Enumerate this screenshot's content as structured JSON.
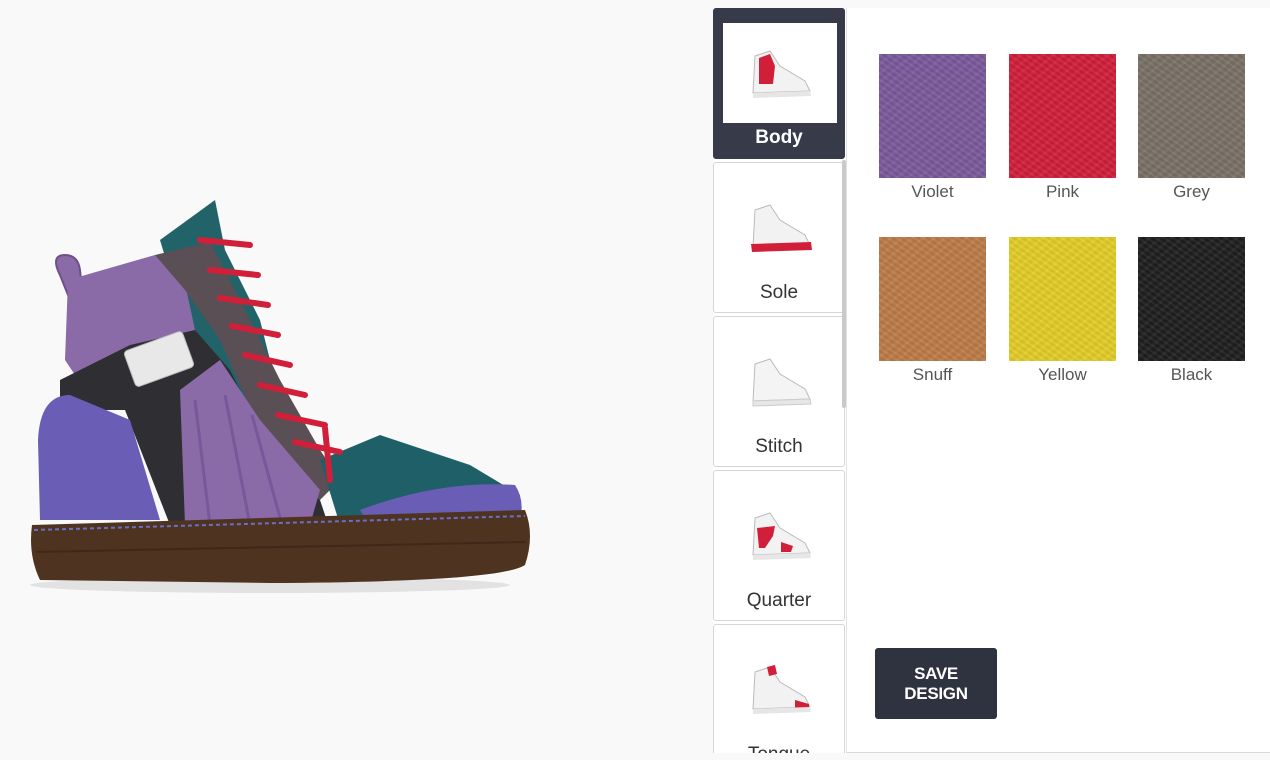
{
  "parts": [
    {
      "label": "Body",
      "active": true
    },
    {
      "label": "Sole",
      "active": false
    },
    {
      "label": "Stitch",
      "active": false
    },
    {
      "label": "Quarter",
      "active": false
    },
    {
      "label": "Tongue",
      "active": false
    }
  ],
  "swatches": [
    {
      "name": "Violet",
      "color": "#7b5a9b"
    },
    {
      "name": "Pink",
      "color": "#d11f3a"
    },
    {
      "name": "Grey",
      "color": "#7a7166"
    },
    {
      "name": "Snuff",
      "color": "#bd7c48"
    },
    {
      "name": "Yellow",
      "color": "#e3cd27"
    },
    {
      "name": "Black",
      "color": "#1f1f1f"
    }
  ],
  "actions": {
    "save_label": "SAVE DESIGN"
  },
  "colors": {
    "accent_dark": "#373b49",
    "highlight_red": "#d11f3a"
  }
}
